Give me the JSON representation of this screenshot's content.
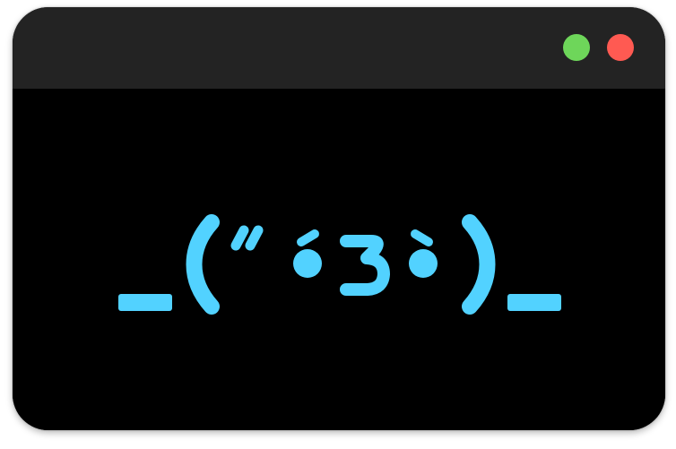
{
  "window": {
    "background": "#000000",
    "titlebar_color": "#232323",
    "controls": [
      {
        "name": "maximize",
        "color": "#6ed65a"
      },
      {
        "name": "close",
        "color": "#ff5a52"
      }
    ]
  },
  "content": {
    "kaomoji": "_(“ ́3 ̀)_",
    "glyph_color": "#52d2ff"
  }
}
